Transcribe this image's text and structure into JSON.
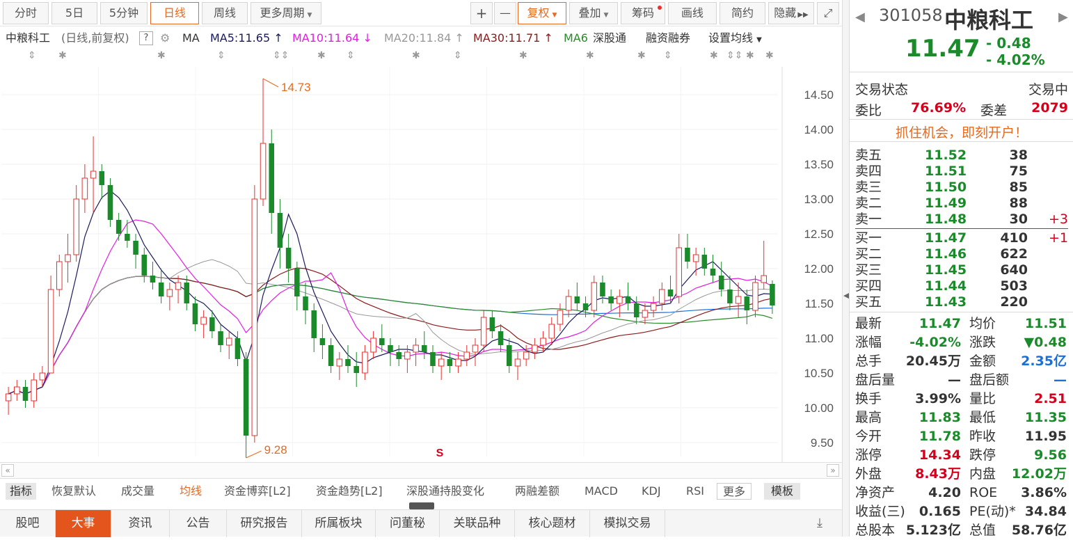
{
  "toolbar": {
    "tabs": [
      "分时",
      "5日",
      "5分钟",
      "日线",
      "周线",
      "更多周期"
    ],
    "plus": "+",
    "minus": "—",
    "fuquan": "复权",
    "diejia": "叠加",
    "chouma": "筹码",
    "huaxian": "画线",
    "jianyue": "简约",
    "yincang": "隐藏"
  },
  "maline": {
    "stock": "中粮科工",
    "mode": "(日线,前复权)",
    "q": "?",
    "ma": "MA",
    "ma5": "MA5:11.65",
    "ma10": "MA10:11.64",
    "ma20": "MA20:11.84",
    "ma30": "MA30:11.71",
    "ma60": "MA6",
    "sgt": "深股通",
    "rzrq": "融资融券",
    "setma": "设置均线"
  },
  "chart": {
    "high_label": "14.73",
    "low_label": "9.28",
    "s_marker": "S",
    "yticks": [
      "14.50",
      "14.00",
      "13.50",
      "13.00",
      "12.50",
      "12.00",
      "11.50",
      "11.00",
      "10.50",
      "10.00",
      "9.50"
    ],
    "colors": {
      "up": "#e8302f",
      "down": "#1a8a2a",
      "ma5": "#1a1a60",
      "ma10": "#e020e0",
      "ma20": "#999999",
      "ma30": "#8b1a1a",
      "ma60": "#2a8a2a",
      "ma120": "#1a6fd8"
    }
  },
  "chart_data": {
    "type": "candlestick",
    "ylim": [
      9.3,
      14.9
    ],
    "candles": [
      [
        10.1,
        10.3,
        9.9,
        10.2
      ],
      [
        10.2,
        10.4,
        10.1,
        10.3
      ],
      [
        10.3,
        10.4,
        10.0,
        10.1
      ],
      [
        10.1,
        10.5,
        10.0,
        10.4
      ],
      [
        10.4,
        10.6,
        10.3,
        10.5
      ],
      [
        10.5,
        11.9,
        10.5,
        11.7
      ],
      [
        11.7,
        12.2,
        11.6,
        12.1
      ],
      [
        12.1,
        12.5,
        11.8,
        12.2
      ],
      [
        12.2,
        13.2,
        12.1,
        13.0
      ],
      [
        13.0,
        13.5,
        12.8,
        13.3
      ],
      [
        13.3,
        13.9,
        12.8,
        13.4
      ],
      [
        13.4,
        13.5,
        13.0,
        13.2
      ],
      [
        13.2,
        13.3,
        12.6,
        12.7
      ],
      [
        12.7,
        12.8,
        12.4,
        12.5
      ],
      [
        12.5,
        12.7,
        12.3,
        12.4
      ],
      [
        12.4,
        12.5,
        12.0,
        12.2
      ],
      [
        12.2,
        12.3,
        11.8,
        11.9
      ],
      [
        11.9,
        12.1,
        11.7,
        11.8
      ],
      [
        11.8,
        12.0,
        11.5,
        11.6
      ],
      [
        11.6,
        11.8,
        11.4,
        11.7
      ],
      [
        11.7,
        11.9,
        11.5,
        11.8
      ],
      [
        11.8,
        11.9,
        11.4,
        11.5
      ],
      [
        11.5,
        11.6,
        11.1,
        11.2
      ],
      [
        11.2,
        11.4,
        11.0,
        11.3
      ],
      [
        11.3,
        11.4,
        11.0,
        11.1
      ],
      [
        11.1,
        11.2,
        10.8,
        10.9
      ],
      [
        10.9,
        11.1,
        10.7,
        11.0
      ],
      [
        11.0,
        11.1,
        10.6,
        10.7
      ],
      [
        10.7,
        10.8,
        9.28,
        9.6
      ],
      [
        9.6,
        13.2,
        9.5,
        13.0
      ],
      [
        13.0,
        14.73,
        12.9,
        13.8
      ],
      [
        13.8,
        14.0,
        12.5,
        12.8
      ],
      [
        12.8,
        13.0,
        12.0,
        12.3
      ],
      [
        12.3,
        12.5,
        11.8,
        12.0
      ],
      [
        12.0,
        12.1,
        11.4,
        11.6
      ],
      [
        11.6,
        11.8,
        11.2,
        11.4
      ],
      [
        11.4,
        11.5,
        10.8,
        11.0
      ],
      [
        11.0,
        11.2,
        10.7,
        10.9
      ],
      [
        10.9,
        11.0,
        10.5,
        10.6
      ],
      [
        10.6,
        10.8,
        10.4,
        10.7
      ],
      [
        10.7,
        10.9,
        10.5,
        10.6
      ],
      [
        10.6,
        10.8,
        10.3,
        10.5
      ],
      [
        10.5,
        10.9,
        10.4,
        10.8
      ],
      [
        10.8,
        11.1,
        10.7,
        11.0
      ],
      [
        11.0,
        11.2,
        10.8,
        10.9
      ],
      [
        10.9,
        11.0,
        10.6,
        10.8
      ],
      [
        10.8,
        10.9,
        10.6,
        10.7
      ],
      [
        10.7,
        10.9,
        10.5,
        10.8
      ],
      [
        10.8,
        11.0,
        10.6,
        10.9
      ],
      [
        10.9,
        11.1,
        10.7,
        10.8
      ],
      [
        10.8,
        10.9,
        10.5,
        10.6
      ],
      [
        10.6,
        10.8,
        10.4,
        10.7
      ],
      [
        10.7,
        10.8,
        10.5,
        10.6
      ],
      [
        10.6,
        10.8,
        10.5,
        10.7
      ],
      [
        10.7,
        10.9,
        10.6,
        10.8
      ],
      [
        10.8,
        11.0,
        10.6,
        10.9
      ],
      [
        10.9,
        11.4,
        10.8,
        11.3
      ],
      [
        11.3,
        11.4,
        11.0,
        11.1
      ],
      [
        11.1,
        11.2,
        10.8,
        10.9
      ],
      [
        10.9,
        11.0,
        10.5,
        10.6
      ],
      [
        10.6,
        10.8,
        10.4,
        10.7
      ],
      [
        10.7,
        10.9,
        10.6,
        10.8
      ],
      [
        10.8,
        11.0,
        10.7,
        10.9
      ],
      [
        10.9,
        11.1,
        10.8,
        11.0
      ],
      [
        11.0,
        11.3,
        10.9,
        11.2
      ],
      [
        11.2,
        11.5,
        11.1,
        11.4
      ],
      [
        11.4,
        11.7,
        11.3,
        11.6
      ],
      [
        11.6,
        11.8,
        11.4,
        11.5
      ],
      [
        11.5,
        11.6,
        11.3,
        11.4
      ],
      [
        11.4,
        11.9,
        11.3,
        11.8
      ],
      [
        11.8,
        11.9,
        11.5,
        11.6
      ],
      [
        11.6,
        11.7,
        11.4,
        11.5
      ],
      [
        11.5,
        11.7,
        11.3,
        11.6
      ],
      [
        11.6,
        11.8,
        11.4,
        11.5
      ],
      [
        11.5,
        11.6,
        11.2,
        11.3
      ],
      [
        11.3,
        11.5,
        11.2,
        11.4
      ],
      [
        11.4,
        11.6,
        11.3,
        11.5
      ],
      [
        11.5,
        11.8,
        11.4,
        11.7
      ],
      [
        11.7,
        11.9,
        11.5,
        11.6
      ],
      [
        11.6,
        12.5,
        11.5,
        12.3
      ],
      [
        12.3,
        12.5,
        12.0,
        12.1
      ],
      [
        12.1,
        12.3,
        11.9,
        12.2
      ],
      [
        12.2,
        12.3,
        11.9,
        12.0
      ],
      [
        12.0,
        12.2,
        11.8,
        11.9
      ],
      [
        11.9,
        12.1,
        11.6,
        11.7
      ],
      [
        11.7,
        11.9,
        11.4,
        11.5
      ],
      [
        11.5,
        11.8,
        11.3,
        11.6
      ],
      [
        11.6,
        11.7,
        11.2,
        11.4
      ],
      [
        11.4,
        11.9,
        11.3,
        11.8
      ],
      [
        11.8,
        12.4,
        11.7,
        11.9
      ],
      [
        11.78,
        11.83,
        11.35,
        11.47
      ]
    ]
  },
  "right": {
    "code": "301058",
    "name": "中粮科工",
    "price": "11.47",
    "change": "- 0.48",
    "pct": "- 4.02%",
    "status_label": "交易状态",
    "status_value": "交易中",
    "weibi_label": "委比",
    "weibi_value": "76.69%",
    "weicha_label": "委差",
    "weicha_value": "2079",
    "promo": "抓住机会，即刻开户！",
    "sells": [
      {
        "label": "卖五",
        "price": "11.52",
        "vol": "38",
        "d": ""
      },
      {
        "label": "卖四",
        "price": "11.51",
        "vol": "75",
        "d": ""
      },
      {
        "label": "卖三",
        "price": "11.50",
        "vol": "85",
        "d": ""
      },
      {
        "label": "卖二",
        "price": "11.49",
        "vol": "88",
        "d": ""
      },
      {
        "label": "卖一",
        "price": "11.48",
        "vol": "30",
        "d": "+3"
      }
    ],
    "buys": [
      {
        "label": "买一",
        "price": "11.47",
        "vol": "410",
        "d": "+1"
      },
      {
        "label": "买二",
        "price": "11.46",
        "vol": "622",
        "d": ""
      },
      {
        "label": "买三",
        "price": "11.45",
        "vol": "640",
        "d": ""
      },
      {
        "label": "买四",
        "price": "11.44",
        "vol": "503",
        "d": ""
      },
      {
        "label": "买五",
        "price": "11.43",
        "vol": "220",
        "d": ""
      }
    ],
    "stats": [
      [
        "最新",
        "11.47",
        "green",
        "均价",
        "11.51",
        "green"
      ],
      [
        "涨幅",
        "-4.02%",
        "green",
        "涨跌",
        "▼0.48",
        "green"
      ],
      [
        "总手",
        "20.45万",
        "",
        "金额",
        "2.35亿",
        "blue"
      ],
      [
        "盘后量",
        "—",
        "",
        "盘后额",
        "—",
        "blue"
      ],
      [
        "换手",
        "3.99%",
        "",
        "量比",
        "2.51",
        "red"
      ],
      [
        "最高",
        "11.83",
        "green",
        "最低",
        "11.35",
        "green"
      ],
      [
        "今开",
        "11.78",
        "green",
        "昨收",
        "11.95",
        ""
      ],
      [
        "涨停",
        "14.34",
        "red",
        "跌停",
        "9.56",
        "green"
      ],
      [
        "外盘",
        "8.43万",
        "red",
        "内盘",
        "12.02万",
        "green"
      ],
      [
        "净资产",
        "4.20",
        "",
        "ROE",
        "3.86%",
        ""
      ],
      [
        "收益(三)",
        "0.165",
        "",
        "PE(动)*",
        "34.84",
        ""
      ],
      [
        "总股本",
        "5.123亿",
        "",
        "总值",
        "58.76亿",
        ""
      ]
    ]
  },
  "indicators": [
    "指标",
    "恢复默认",
    "成交量",
    "均线",
    "资金博弈[L2]",
    "资金趋势[L2]",
    "深股通持股变化",
    "两融差额",
    "MACD",
    "KDJ",
    "RSI",
    "更多",
    "模板"
  ],
  "bottomtabs": [
    "股吧",
    "大事",
    "资讯",
    "公告",
    "研究报告",
    "所属板块",
    "问董秘",
    "关联品种",
    "核心题材",
    "模拟交易"
  ]
}
